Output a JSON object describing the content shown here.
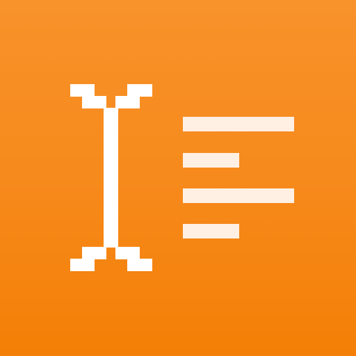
{
  "app_icon": {
    "icon_name": "text-cursor-document-icon",
    "colors": {
      "background_top": "#f8922b",
      "background_bottom": "#f47f06",
      "cursor": "#ffffff",
      "text_lines": "#fff0e3"
    },
    "cursor_icon": "i-beam-cursor-icon",
    "text_lines": [
      {
        "name": "text-line-long-1"
      },
      {
        "name": "text-line-short-1"
      },
      {
        "name": "text-line-long-2"
      },
      {
        "name": "text-line-short-2"
      }
    ]
  }
}
